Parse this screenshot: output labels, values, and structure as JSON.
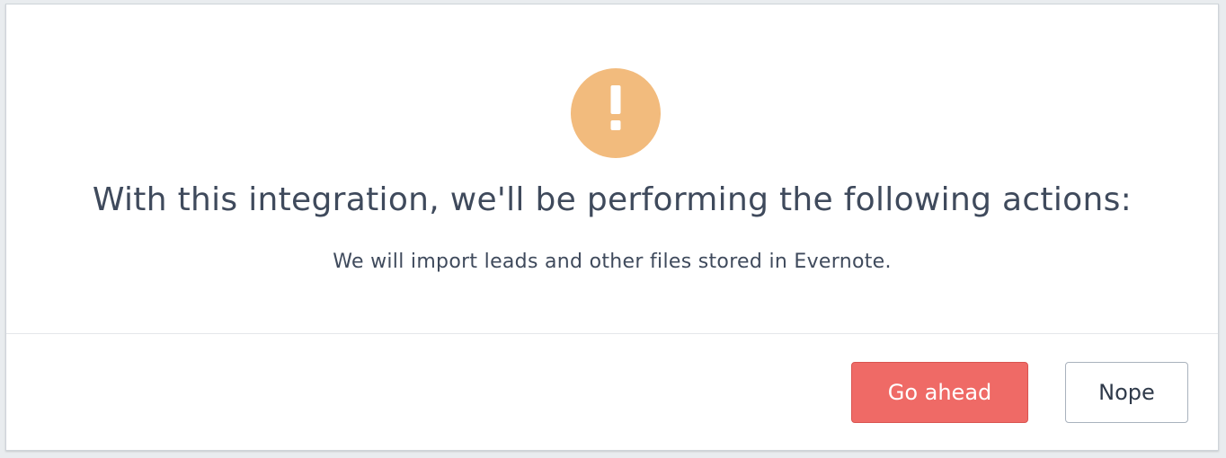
{
  "dialog": {
    "icon": "exclamation-icon",
    "title": "With this integration, we'll be performing the following actions:",
    "description": "We will import leads and other files stored in Evernote.",
    "actions": {
      "confirm_label": "Go ahead",
      "cancel_label": "Nope"
    }
  },
  "colors": {
    "warning": "#f2bb7d",
    "primary": "#ef6a66",
    "text": "#3f4a5c"
  }
}
